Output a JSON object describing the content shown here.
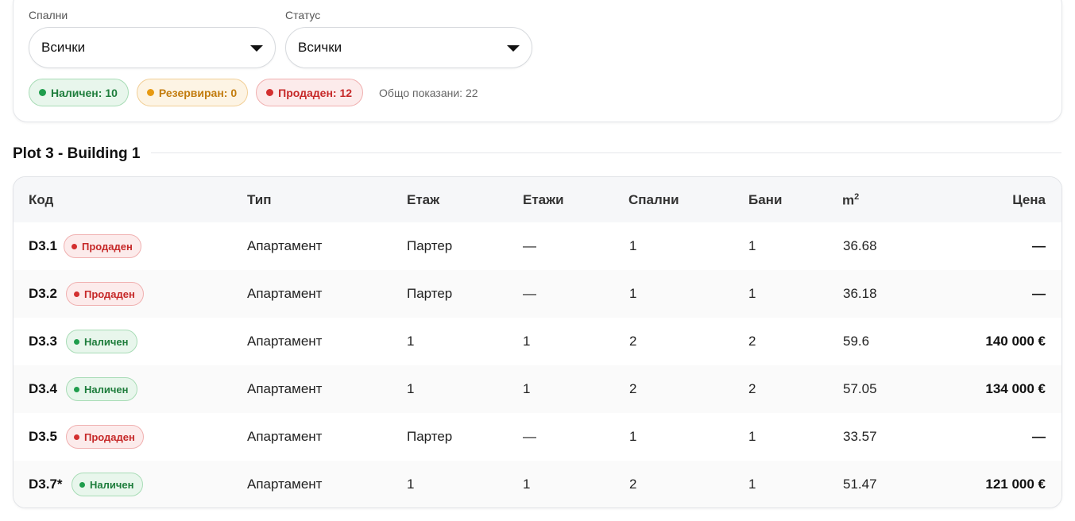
{
  "filters": {
    "bedrooms": {
      "label": "Спални",
      "value": "Всички"
    },
    "status": {
      "label": "Статус",
      "value": "Всички"
    },
    "pills": [
      {
        "text": "Наличен: 10",
        "color": "#1f9d4c"
      },
      {
        "text": "Резервиран: 0",
        "color": "#e79a13"
      },
      {
        "text": "Продаден: 12",
        "color": "#d32f2f"
      }
    ],
    "total_text": "Общо показани: 22"
  },
  "section": {
    "title": "Plot 3 - Building 1"
  },
  "table": {
    "headers": {
      "code": "Код",
      "type": "Тип",
      "floor": "Етаж",
      "floors": "Етажи",
      "bedrooms": "Спални",
      "bathrooms": "Бани",
      "area": "m",
      "area_sup": "2",
      "price": "Цена"
    },
    "rows": [
      {
        "code": "D3.1",
        "status": "Продаден",
        "type": "Апартамент",
        "floor": "Партер",
        "floors": "—",
        "bedrooms": "1",
        "bathrooms": "1",
        "area": "36.68",
        "price": "—"
      },
      {
        "code": "D3.2",
        "status": "Продаден",
        "type": "Апартамент",
        "floor": "Партер",
        "floors": "—",
        "bedrooms": "1",
        "bathrooms": "1",
        "area": "36.18",
        "price": "—"
      },
      {
        "code": "D3.3",
        "status": "Наличен",
        "type": "Апартамент",
        "floor": "1",
        "floors": "1",
        "bedrooms": "2",
        "bathrooms": "2",
        "area": "59.6",
        "price": "140 000 €"
      },
      {
        "code": "D3.4",
        "status": "Наличен",
        "type": "Апартамент",
        "floor": "1",
        "floors": "1",
        "bedrooms": "2",
        "bathrooms": "2",
        "area": "57.05",
        "price": "134 000 €"
      },
      {
        "code": "D3.5",
        "status": "Продаден",
        "type": "Апартамент",
        "floor": "Партер",
        "floors": "—",
        "bedrooms": "1",
        "bathrooms": "1",
        "area": "33.57",
        "price": "—"
      },
      {
        "code": "D3.7*",
        "status": "Наличен",
        "type": "Апартамент",
        "floor": "1",
        "floors": "1",
        "bedrooms": "2",
        "bathrooms": "1",
        "area": "51.47",
        "price": "121 000 €"
      }
    ]
  }
}
